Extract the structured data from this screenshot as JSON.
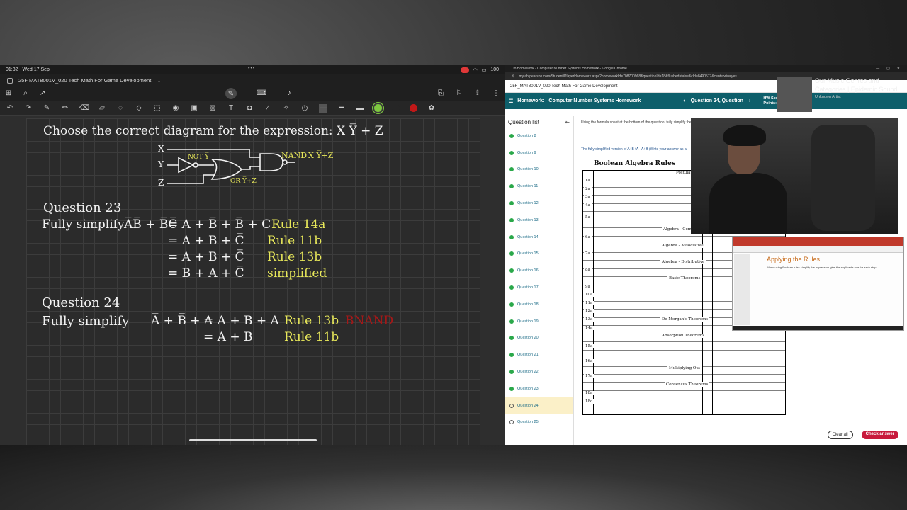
{
  "ipad": {
    "time": "01:32",
    "date": "Wed 17 Sep",
    "battery": "100"
  },
  "notes": {
    "doc_title": "25F MAT8001V_020 Tech Math For Game Development",
    "q22_text": "Choose the correct diagram for the expression:  X Y̅ + Z",
    "gate_x": "X",
    "gate_y": "Y",
    "gate_z": "Z",
    "gate_not": "NOT Y̅",
    "gate_or": "OR Y̅+Z",
    "gate_nand": "NAND",
    "gate_nand_expr": "X Y̅+Z",
    "q23_title": "Question 23",
    "q23_prompt": "Fully simplify",
    "q23_expr": "A̅B̅ + B̅C̅",
    "q23_lines": [
      {
        "eq": "=  A + B̅ + B̅ + C",
        "rule": "Rule 14a"
      },
      {
        "eq": "=  A + B + C̅",
        "rule": "Rule 11b"
      },
      {
        "eq": "=  A + B + C̅",
        "rule": "Rule 13b"
      },
      {
        "eq": "=  B + A + C̅",
        "rule": "simplified"
      }
    ],
    "q24_title": "Question 24",
    "q24_prompt": "Fully simplify",
    "q24_expr": "A̅ + B̅ + A",
    "q24_lines": [
      {
        "eq": "=  A + B + A",
        "rule": "Rule 13b"
      },
      {
        "eq": "=  A + B",
        "rule": "Rule 11b"
      }
    ],
    "q24_note": "BNAND",
    "colors": {
      "ink_white": "#f2f2f2",
      "ink_yellow": "#e8e85a",
      "ink_red": "#a51818",
      "pen_green": "#7ec840",
      "pen_red": "#c01818"
    }
  },
  "browser": {
    "window_title": "Do Homework - Computer Number Systems Homework - Google Chrome",
    "url": "mylab.pearson.com/Student/PlayerHomework.aspx?homeworkId=708700968&questionId=18&flushed=false&cId=8490577&centerwin=yes",
    "course": "25F_MAT8001V_020 Tech Math For Game Development",
    "homework_label": "Homework:",
    "homework_name": "Computer Number Systems Homework",
    "question_nav": "Question 24, Question",
    "hw_score": "HW Score: 92%, 2",
    "points": "Points: 0 of 1",
    "question_list_title": "Question list",
    "questions": [
      "Question 8",
      "Question 9",
      "Question 10",
      "Question 11",
      "Question 12",
      "Question 13",
      "Question 14",
      "Question 15",
      "Question 16",
      "Question 17",
      "Question 18",
      "Question 19",
      "Question 20",
      "Question 21",
      "Question 22",
      "Question 23",
      "Question 24",
      "Question 25"
    ],
    "active_question": "Question 24",
    "instruction": "Using the formula sheet at the bottom of the question, fully simplify the f",
    "prompt": "The fully simplified version of A̅+B̅+A · A+B (Write your answer as a",
    "rules_title": "Boolean Algebra Rules",
    "rule_sections": [
      "Postulat",
      "Algebra - Comm",
      "Algebra - Associative",
      "Algebra - Distributive",
      "Basic Theorems",
      "De Morgan's Theorems",
      "Absorption Theorems",
      "Multiplying Out",
      "Consensus Theorems"
    ],
    "rule_ids": [
      "1a",
      "2a",
      "3a",
      "4a",
      "5a",
      "6a",
      "7a",
      "8a",
      "9a",
      "10a",
      "11a",
      "12a",
      "13a",
      "14a",
      "15a",
      "16a",
      "17a",
      "18a",
      "18c"
    ],
    "clear_all": "Clear all",
    "check_answer": "Check answer"
  },
  "overlay": {
    "music_title": "Our Music Genres and Categories | Epidemic Sound",
    "music_artist": "Unknown Artist",
    "slide_title": "Applying the Rules",
    "slide_text": "When using Boolean rules simplify the expression give the applicable rule for each step."
  }
}
